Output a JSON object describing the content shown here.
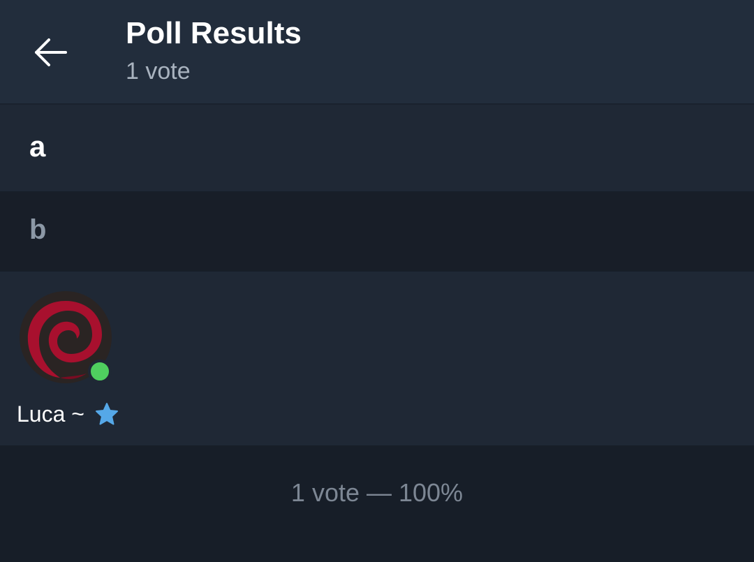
{
  "header": {
    "back_icon": "arrow-left-icon",
    "title": "Poll Results",
    "subtitle": "1 vote"
  },
  "options": [
    {
      "label": "a"
    },
    {
      "label": "b"
    }
  ],
  "voters": [
    {
      "name": "Luca ~",
      "badge_icon": "star-badge-icon",
      "online": true,
      "avatar_icon": "debian-swirl-icon"
    }
  ],
  "footer": {
    "summary": "1 vote — 100%"
  },
  "colors": {
    "header_bg": "#222d3c",
    "row_bg": "#1f2835",
    "dim_bg": "#171e28",
    "online": "#4fcf5f",
    "badge": "#55a8e8",
    "avatar_swirl": "#a8102e"
  }
}
